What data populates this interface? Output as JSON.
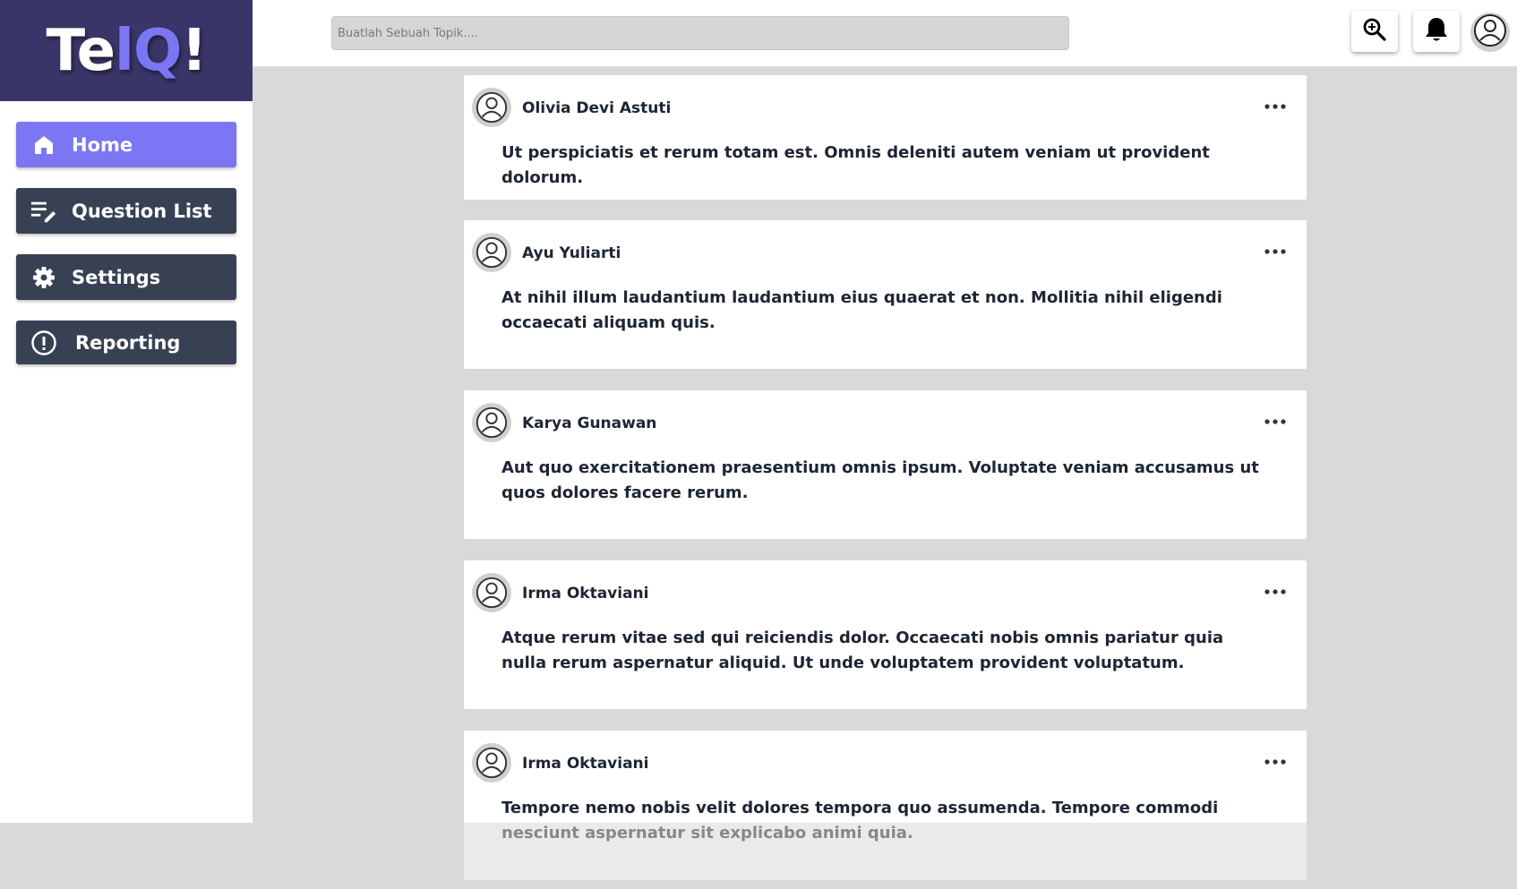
{
  "brand": {
    "logo_part1": "Te",
    "logo_part2": "lQ",
    "logo_part3": "!"
  },
  "colors": {
    "brand_bg": "#3a3568",
    "accent": "#7b76f4",
    "nav_bg": "#374153",
    "text": "#1e2533"
  },
  "sidebar": {
    "items": [
      {
        "label": "Home",
        "icon": "home-icon",
        "active": true
      },
      {
        "label": "Question List",
        "icon": "list-edit-icon",
        "active": false
      },
      {
        "label": "Settings",
        "icon": "gear-icon",
        "active": false
      },
      {
        "label": "Reporting",
        "icon": "alert-circle-icon",
        "active": false
      }
    ]
  },
  "search": {
    "placeholder": "Buatlah Sebuah Topik....",
    "value": ""
  },
  "header_icons": [
    "search-zoom-icon",
    "bell-icon",
    "user-avatar-icon"
  ],
  "feed": {
    "posts": [
      {
        "author": "Olivia Devi Astuti",
        "text": "Ut perspiciatis et rerum totam est. Omnis deleniti autem veniam ut provident dolorum."
      },
      {
        "author": "Ayu Yuliarti",
        "text": "At nihil illum laudantium laudantium eius quaerat et non. Mollitia nihil eligendi occaecati aliquam quis."
      },
      {
        "author": "Karya Gunawan",
        "text": "Aut quo exercitationem praesentium omnis ipsum. Voluptate veniam accusamus ut quos dolores facere rerum."
      },
      {
        "author": "Irma Oktaviani",
        "text": "Atque rerum vitae sed qui reiciendis dolor. Occaecati nobis omnis pariatur quia nulla rerum aspernatur aliquid. Ut unde voluptatem provident voluptatum."
      },
      {
        "author": "Irma Oktaviani",
        "text": "Tempore nemo nobis velit dolores tempora quo assumenda. Tempore commodi nesciunt aspernatur sit explicabo animi quia."
      }
    ]
  }
}
